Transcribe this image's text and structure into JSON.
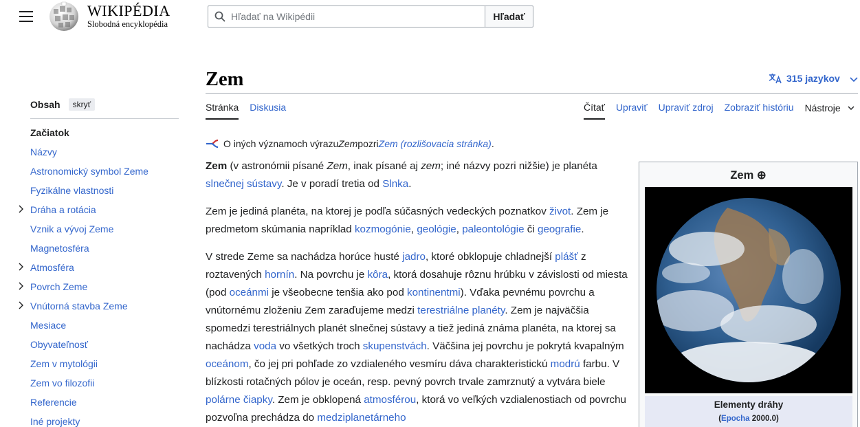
{
  "header": {
    "wordmark_title": "WIKIPÉDIA",
    "wordmark_tagline": "Slobodná encyklopédia",
    "search_placeholder": "Hľadať na Wikipédii",
    "search_button": "Hľadať"
  },
  "page": {
    "title": "Zem",
    "languages": "315 jazykov"
  },
  "tabs": {
    "left": [
      "Stránka",
      "Diskusia"
    ],
    "right": [
      "Čítať",
      "Upraviť",
      "Upraviť zdroj",
      "Zobraziť históriu",
      "Nástroje"
    ]
  },
  "toc": {
    "title": "Obsah",
    "hide": "skryť",
    "items": [
      "Začiatok",
      "Názvy",
      "Astronomický symbol Zeme",
      "Fyzikálne vlastnosti",
      "Dráha a rotácia",
      "Vznik a vývoj Zeme",
      "Magnetosféra",
      "Atmosféra",
      "Povrch Zeme",
      "Vnútorná stavba Zeme",
      "Mesiace",
      "Obyvateľnosť",
      "Zem v mytológii",
      "Zem vo filozofii",
      "Referencie",
      "Iné projekty"
    ]
  },
  "hatnote": {
    "t1": "O iných významoch výrazu ",
    "t2": "Zem",
    "t3": " pozri ",
    "link": "Zem (rozlišovacia stránka)",
    "t4": "."
  },
  "paragraphs": {
    "p1": [
      {
        "t": "b",
        "v": "Zem"
      },
      {
        "t": "s",
        "v": " (v astronómii písané "
      },
      {
        "t": "i",
        "v": "Zem"
      },
      {
        "t": "s",
        "v": ", inak písané aj "
      },
      {
        "t": "i",
        "v": "zem"
      },
      {
        "t": "s",
        "v": "; iné názvy pozri nižšie) je planéta "
      },
      {
        "t": "a",
        "v": "slnečnej sústavy"
      },
      {
        "t": "s",
        "v": ". Je v poradí tretia od "
      },
      {
        "t": "a",
        "v": "Slnka"
      },
      {
        "t": "s",
        "v": "."
      }
    ],
    "p2": [
      {
        "t": "s",
        "v": "Zem je jediná planéta, na ktorej je podľa súčasných vedeckých poznatkov "
      },
      {
        "t": "a",
        "v": "život"
      },
      {
        "t": "s",
        "v": ". Zem je predmetom skúmania napríklad "
      },
      {
        "t": "a",
        "v": "kozmogónie"
      },
      {
        "t": "s",
        "v": ", "
      },
      {
        "t": "a",
        "v": "geológie"
      },
      {
        "t": "s",
        "v": ", "
      },
      {
        "t": "a",
        "v": "paleontológie"
      },
      {
        "t": "s",
        "v": " či "
      },
      {
        "t": "a",
        "v": "geografie"
      },
      {
        "t": "s",
        "v": "."
      }
    ],
    "p3": [
      {
        "t": "s",
        "v": "V strede Zeme sa nachádza horúce husté "
      },
      {
        "t": "a",
        "v": "jadro"
      },
      {
        "t": "s",
        "v": ", ktoré obklopuje chladnejší "
      },
      {
        "t": "a",
        "v": "plášť"
      },
      {
        "t": "s",
        "v": " z roztavených "
      },
      {
        "t": "a",
        "v": "hornín"
      },
      {
        "t": "s",
        "v": ". Na povrchu je "
      },
      {
        "t": "a",
        "v": "kôra"
      },
      {
        "t": "s",
        "v": ", ktorá dosahuje rôznu hrúbku v závislosti od miesta (pod "
      },
      {
        "t": "a",
        "v": "oceánmi"
      },
      {
        "t": "s",
        "v": " je všeobecne tenšia ako pod "
      },
      {
        "t": "a",
        "v": "kontinentmi"
      },
      {
        "t": "s",
        "v": "). Vďaka pevnému povrchu a vnútornému zloženiu Zem zaraďujeme medzi "
      },
      {
        "t": "a",
        "v": "terestriálne planéty"
      },
      {
        "t": "s",
        "v": ". Zem je najväčšia spomedzi terestriálnych planét slnečnej sústavy a tiež jediná známa planéta, na ktorej sa nachádza "
      },
      {
        "t": "a",
        "v": "voda"
      },
      {
        "t": "s",
        "v": " vo všetkých troch "
      },
      {
        "t": "a",
        "v": "skupenstvách"
      },
      {
        "t": "s",
        "v": ". Väčšina jej povrchu je pokrytá kvapalným "
      },
      {
        "t": "a",
        "v": "oceánom"
      },
      {
        "t": "s",
        "v": ", čo jej pri pohľade zo vzdialeného vesmíru dáva charakteristickú "
      },
      {
        "t": "a",
        "v": "modrú"
      },
      {
        "t": "s",
        "v": " farbu. V blízkosti rotačných pólov je oceán, resp. pevný povrch trvale zamrznutý a vytvára biele "
      },
      {
        "t": "a",
        "v": "polárne čiapky"
      },
      {
        "t": "s",
        "v": ". Zem je obklopená "
      },
      {
        "t": "a",
        "v": "atmosférou"
      },
      {
        "t": "s",
        "v": ", ktorá vo veľkých vzdialenostiach od povrchu pozvoľna prechádza do "
      },
      {
        "t": "a",
        "v": "medziplanetárneho"
      }
    ]
  },
  "infobox": {
    "title": "Zem ⊕",
    "section_title": "Elementy dráhy",
    "sub_open": "(",
    "sub_link": "Epocha",
    "sub_rest": " 2000.0)"
  },
  "colors": {
    "link": "#3366cc",
    "text": "#202122",
    "infobox_bg": "#f8f9fa",
    "infobox_section_bg": "#e6e9f5"
  }
}
